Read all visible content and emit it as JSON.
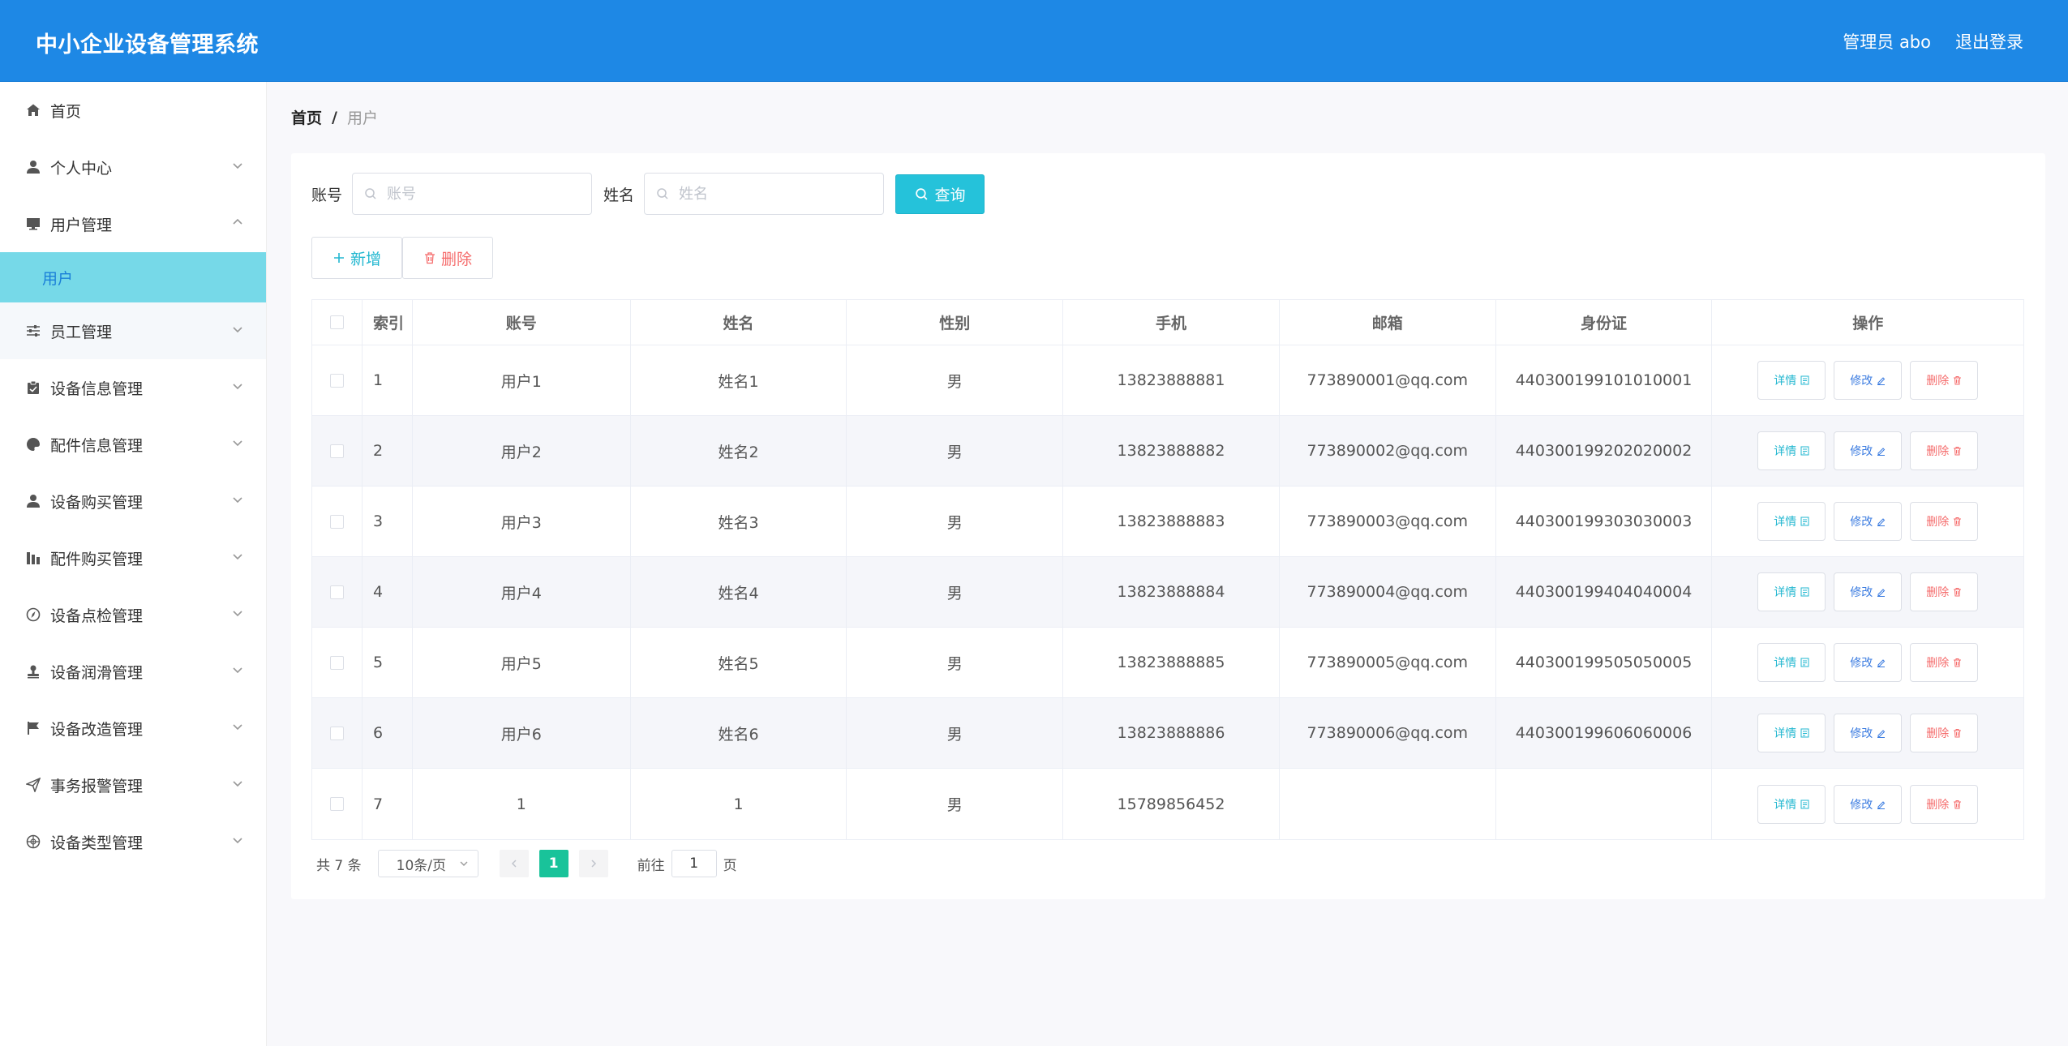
{
  "header": {
    "app_title": "中小企业设备管理系统",
    "user_label": "管理员 abo",
    "logout_label": "退出登录"
  },
  "sidebar": {
    "items": [
      {
        "label": "首页",
        "icon": "home-icon"
      },
      {
        "label": "个人中心",
        "icon": "user-icon"
      },
      {
        "label": "用户管理",
        "icon": "monitor-icon"
      },
      {
        "label": "用户",
        "icon": ""
      },
      {
        "label": "员工管理",
        "icon": "sliders-icon"
      },
      {
        "label": "设备信息管理",
        "icon": "clipboard-icon"
      },
      {
        "label": "配件信息管理",
        "icon": "palette-icon"
      },
      {
        "label": "设备购买管理",
        "icon": "user-icon"
      },
      {
        "label": "配件购买管理",
        "icon": "chart-icon"
      },
      {
        "label": "设备点检管理",
        "icon": "compass-icon"
      },
      {
        "label": "设备润滑管理",
        "icon": "stamp-icon"
      },
      {
        "label": "设备改造管理",
        "icon": "flag-icon"
      },
      {
        "label": "事务报警管理",
        "icon": "send-icon"
      },
      {
        "label": "设备类型管理",
        "icon": "globe-icon"
      }
    ]
  },
  "breadcrumb": {
    "home": "首页",
    "separator": "/",
    "current": "用户"
  },
  "search": {
    "account_label": "账号",
    "account_placeholder": "账号",
    "name_label": "姓名",
    "name_placeholder": "姓名",
    "query_label": "查询"
  },
  "actions": {
    "add_label": "新增",
    "delete_label": "删除"
  },
  "table": {
    "headers": [
      "索引",
      "账号",
      "姓名",
      "性别",
      "手机",
      "邮箱",
      "身份证",
      "操作"
    ],
    "op_labels": {
      "detail": "详情",
      "edit": "修改",
      "delete": "删除"
    },
    "rows": [
      {
        "idx": "1",
        "account": "用户1",
        "name": "姓名1",
        "gender": "男",
        "phone": "13823888881",
        "email": "773890001@qq.com",
        "id_card": "440300199101010001"
      },
      {
        "idx": "2",
        "account": "用户2",
        "name": "姓名2",
        "gender": "男",
        "phone": "13823888882",
        "email": "773890002@qq.com",
        "id_card": "440300199202020002"
      },
      {
        "idx": "3",
        "account": "用户3",
        "name": "姓名3",
        "gender": "男",
        "phone": "13823888883",
        "email": "773890003@qq.com",
        "id_card": "440300199303030003"
      },
      {
        "idx": "4",
        "account": "用户4",
        "name": "姓名4",
        "gender": "男",
        "phone": "13823888884",
        "email": "773890004@qq.com",
        "id_card": "440300199404040004"
      },
      {
        "idx": "5",
        "account": "用户5",
        "name": "姓名5",
        "gender": "男",
        "phone": "13823888885",
        "email": "773890005@qq.com",
        "id_card": "440300199505050005"
      },
      {
        "idx": "6",
        "account": "用户6",
        "name": "姓名6",
        "gender": "男",
        "phone": "13823888886",
        "email": "773890006@qq.com",
        "id_card": "440300199606060006"
      },
      {
        "idx": "7",
        "account": "1",
        "name": "1",
        "gender": "男",
        "phone": "15789856452",
        "email": "",
        "id_card": ""
      }
    ]
  },
  "pagination": {
    "total_text": "共 7 条",
    "page_size": "10条/页",
    "current_page": "1",
    "goto_prefix": "前往",
    "goto_value": "1",
    "goto_suffix": "页"
  },
  "colors": {
    "header_bg": "#1e88e5",
    "accent": "#25c2da",
    "active_sub_bg": "#76d9e8",
    "danger": "#f56c6c",
    "page_active": "#19c39a"
  }
}
